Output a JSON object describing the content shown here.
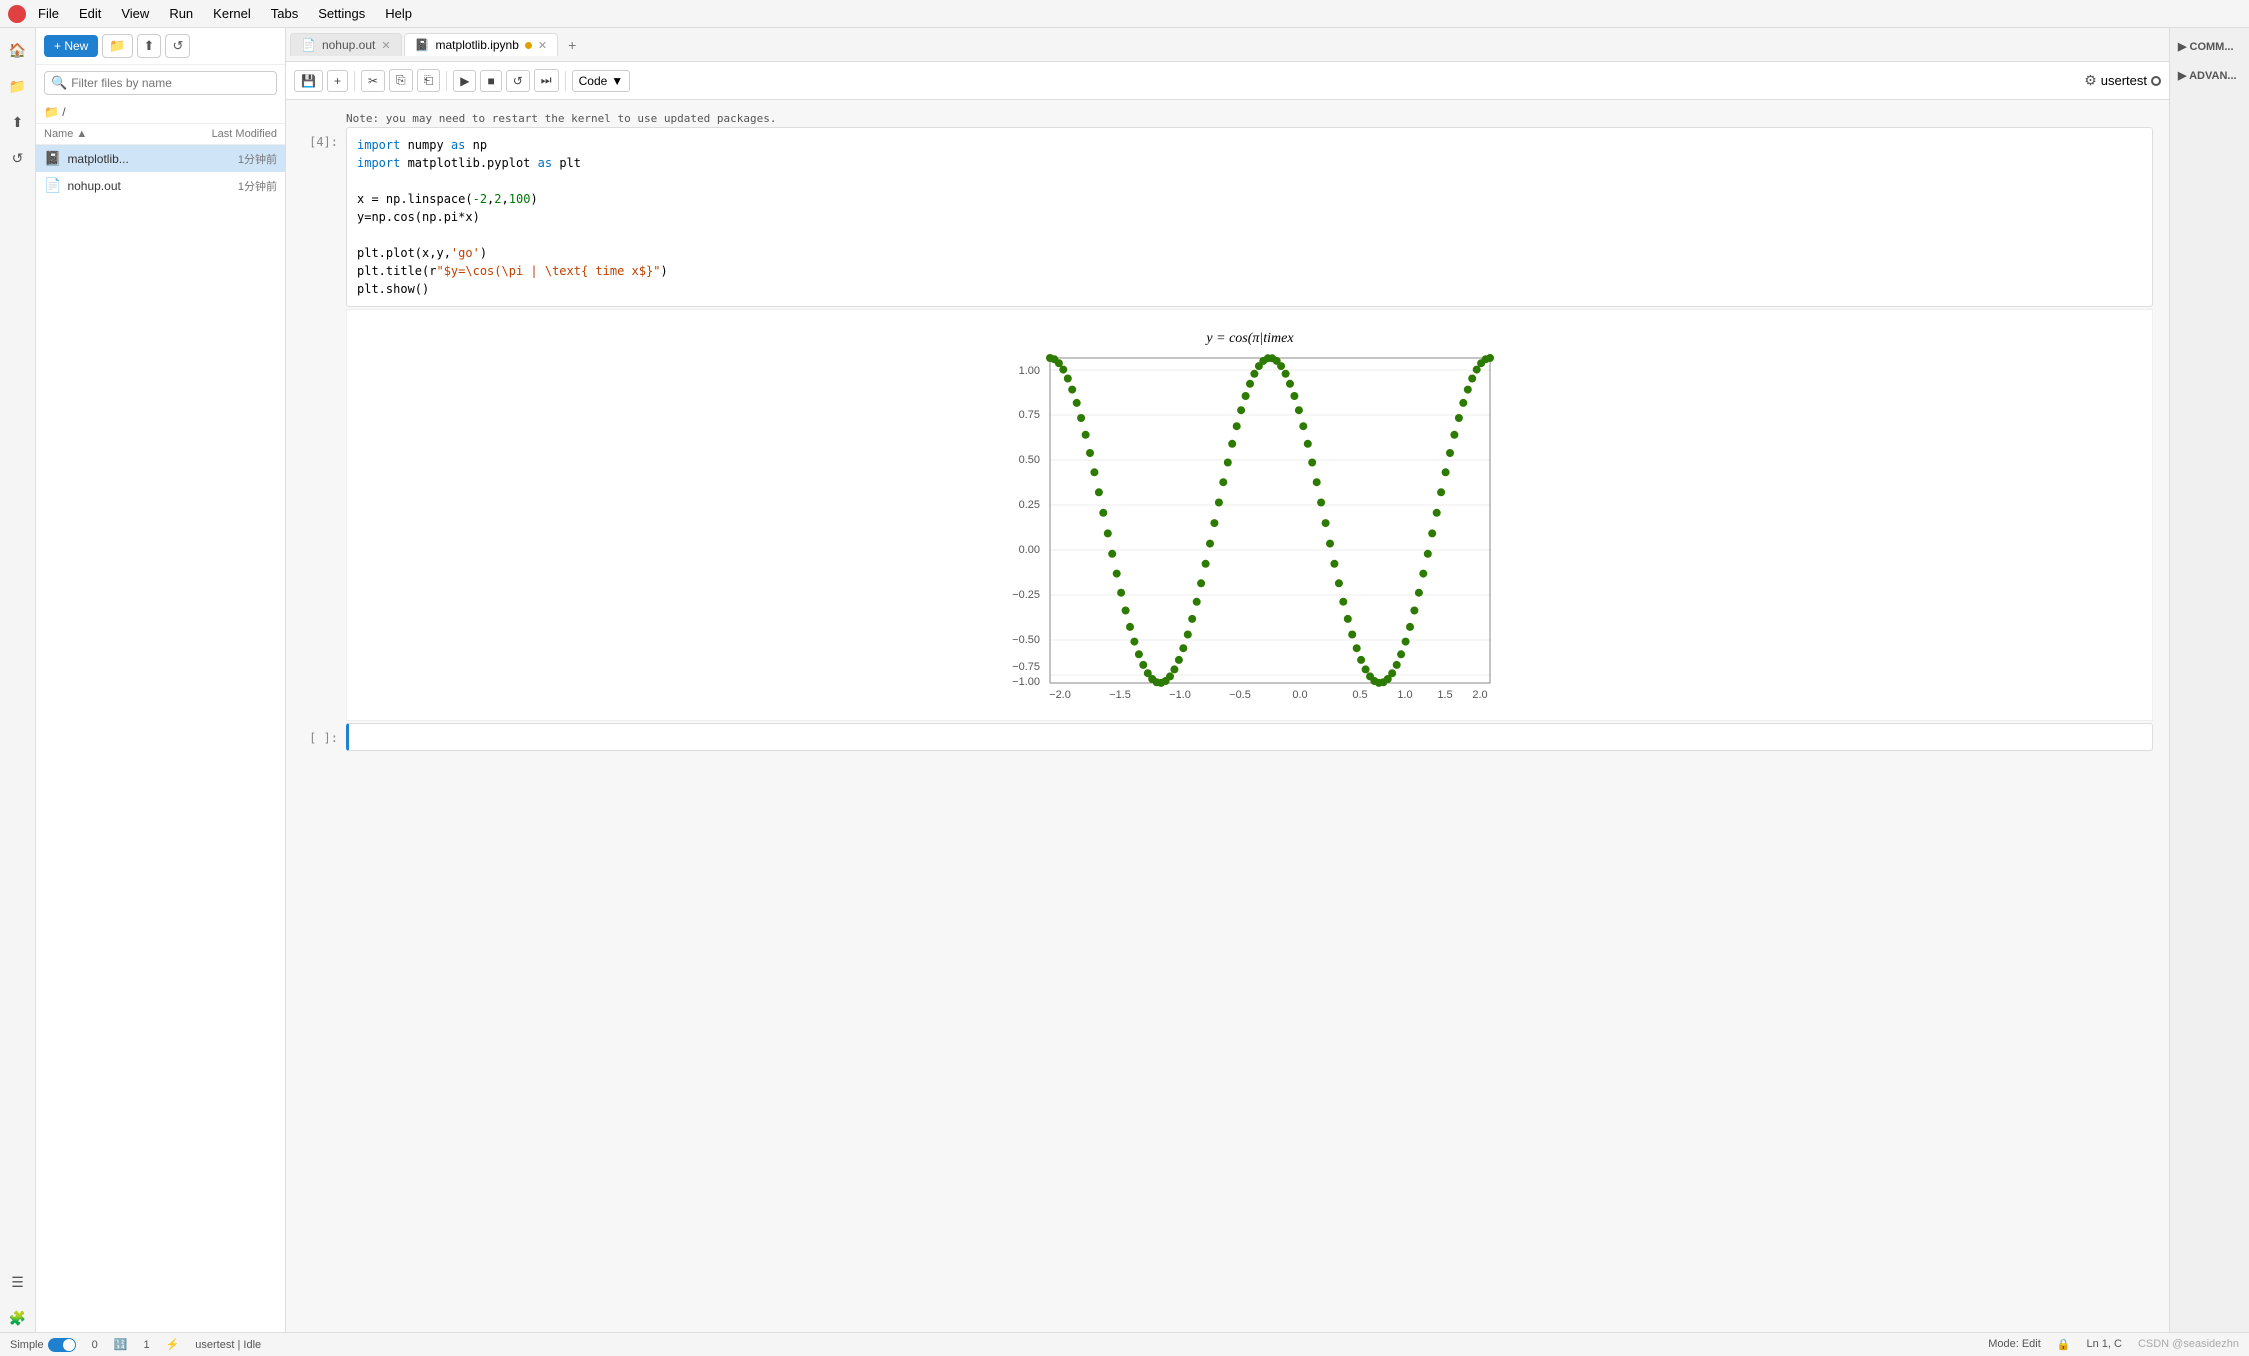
{
  "menu": {
    "logo_label": "🔵",
    "items": [
      "File",
      "Edit",
      "View",
      "Run",
      "Kernel",
      "Tabs",
      "Settings",
      "Help"
    ]
  },
  "file_panel": {
    "new_button": "+ New",
    "search_placeholder": "Filter files by name",
    "breadcrumb": "📁 /",
    "columns": {
      "name": "Name",
      "modified": "Last Modified"
    },
    "files": [
      {
        "name": "matplotlib...",
        "icon": "📓",
        "time": "1分钟前",
        "active": true,
        "color": "#e0a000"
      },
      {
        "name": "nohup.out",
        "icon": "📄",
        "time": "1分钟前",
        "active": false,
        "color": ""
      }
    ]
  },
  "tabs": [
    {
      "label": "nohup.out",
      "icon": "📄",
      "active": false,
      "dot": false,
      "closable": true
    },
    {
      "label": "matplotlib.ipynb",
      "icon": "📓",
      "active": true,
      "dot": true,
      "closable": true
    }
  ],
  "toolbar": {
    "save": "💾",
    "add": "+",
    "cut": "✂",
    "copy": "⎘",
    "paste": "⎗",
    "run": "▶",
    "stop": "■",
    "restart": "↺",
    "fast_forward": "⏭",
    "cell_type": "Code",
    "settings_icon": "⚙",
    "kernel_user": "usertest"
  },
  "notebook": {
    "notice": "Note: you may need to restart the kernel to use updated packages.",
    "cell1": {
      "label": "[4]:",
      "lines": [
        {
          "parts": [
            {
              "text": "import",
              "cls": "kw"
            },
            {
              "text": " numpy ",
              "cls": "var"
            },
            {
              "text": "as",
              "cls": "kw"
            },
            {
              "text": " np",
              "cls": "var"
            }
          ]
        },
        {
          "parts": [
            {
              "text": "import",
              "cls": "kw"
            },
            {
              "text": " matplotlib.pyplot ",
              "cls": "var"
            },
            {
              "text": "as",
              "cls": "kw"
            },
            {
              "text": " plt",
              "cls": "var"
            }
          ]
        },
        {
          "parts": [
            {
              "text": "",
              "cls": "var"
            }
          ]
        },
        {
          "parts": [
            {
              "text": "x",
              "cls": "var"
            },
            {
              "text": " = ",
              "cls": "var"
            },
            {
              "text": "np",
              "cls": "var"
            },
            {
              "text": ".linspace(",
              "cls": "var"
            },
            {
              "text": "-2",
              "cls": "num"
            },
            {
              "text": ",",
              "cls": "var"
            },
            {
              "text": "2",
              "cls": "num"
            },
            {
              "text": ",",
              "cls": "var"
            },
            {
              "text": "100",
              "cls": "num"
            },
            {
              "text": ")",
              "cls": "var"
            }
          ]
        },
        {
          "parts": [
            {
              "text": "y",
              "cls": "var"
            },
            {
              "text": "=np.cos(np.pi*x)",
              "cls": "var"
            }
          ]
        },
        {
          "parts": [
            {
              "text": "",
              "cls": "var"
            }
          ]
        },
        {
          "parts": [
            {
              "text": "plt",
              "cls": "var"
            },
            {
              "text": ".plot(x,y,",
              "cls": "var"
            },
            {
              "text": "'go'",
              "cls": "str"
            },
            {
              "text": ")",
              "cls": "var"
            }
          ]
        },
        {
          "parts": [
            {
              "text": "plt",
              "cls": "var"
            },
            {
              "text": ".title(r",
              "cls": "var"
            },
            {
              "text": "\"$y=\\cos(\\pi | \\text{ time x$}\"",
              "cls": "str"
            },
            {
              "text": ")",
              "cls": "var"
            }
          ]
        },
        {
          "parts": [
            {
              "text": "plt",
              "cls": "var"
            },
            {
              "text": ".show()",
              "cls": "var"
            }
          ]
        }
      ]
    },
    "plot_title": "y = cos(π|timex",
    "cell2_label": "[ ]:"
  },
  "status_bar": {
    "mode": "Simple",
    "count1": "0",
    "icon1": "🔢",
    "count2": "1",
    "icon2": "⚡",
    "user": "usertest",
    "state": "Idle",
    "mode_label": "Mode: Edit",
    "ln_col": "Ln 1, C",
    "watermark": "CSDN @seasidezhn"
  },
  "right_sidebar": {
    "items": [
      "▶ COMM...",
      "▶ ADVAN..."
    ]
  },
  "colors": {
    "accent_blue": "#2080d0",
    "plot_green": "#2d7a00",
    "tab_dot": "#e0a000"
  }
}
